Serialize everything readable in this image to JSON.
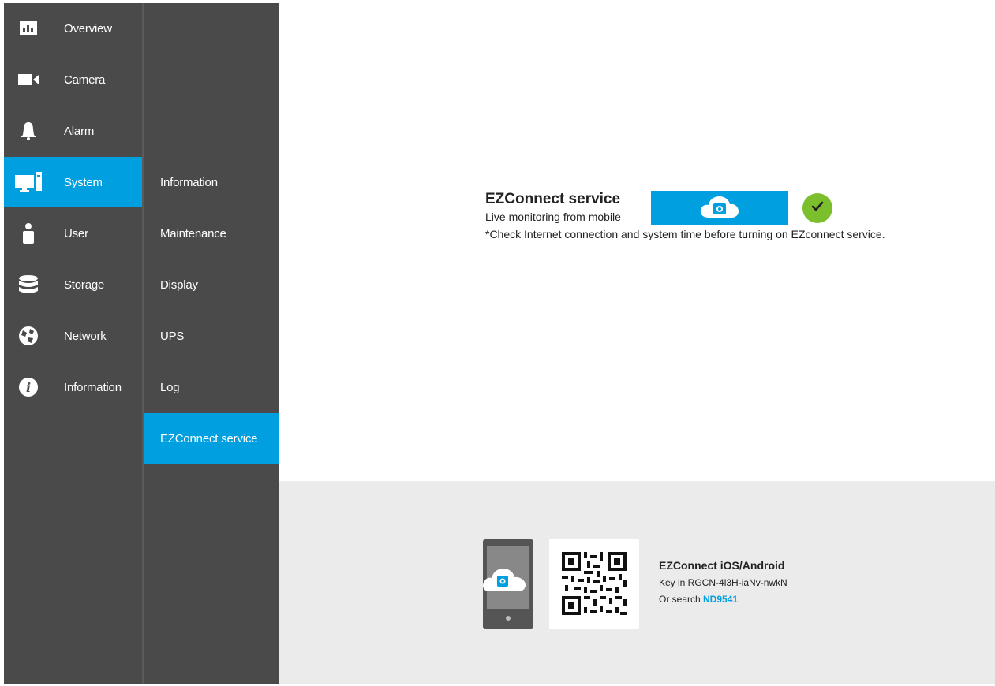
{
  "colors": {
    "sidebar_bg": "#4a4a4a",
    "accent": "#009fe0",
    "success": "#7cbf2d",
    "bottom_panel": "#ebebeb"
  },
  "sidebar": {
    "items": [
      {
        "label": "Overview",
        "icon": "overview-icon",
        "active": false
      },
      {
        "label": "Camera",
        "icon": "camera-icon",
        "active": false
      },
      {
        "label": "Alarm",
        "icon": "bell-icon",
        "active": false
      },
      {
        "label": "System",
        "icon": "system-icon",
        "active": true
      },
      {
        "label": "User",
        "icon": "user-icon",
        "active": false
      },
      {
        "label": "Storage",
        "icon": "storage-icon",
        "active": false
      },
      {
        "label": "Network",
        "icon": "globe-icon",
        "active": false
      },
      {
        "label": "Information",
        "icon": "info-icon",
        "active": false
      }
    ]
  },
  "subnav": {
    "items": [
      {
        "label": "Information",
        "active": false
      },
      {
        "label": "Maintenance",
        "active": false
      },
      {
        "label": "Display",
        "active": false
      },
      {
        "label": "UPS",
        "active": false
      },
      {
        "label": "Log",
        "active": false
      },
      {
        "label": "EZConnect service",
        "active": true
      }
    ]
  },
  "service": {
    "title": "EZConnect service",
    "subtitle": "Live monitoring from mobile",
    "note": "*Check Internet connection and system time before turning on EZconnect service.",
    "button_icon": "cloud-camera-icon",
    "status_icon": "check-icon",
    "status": "enabled"
  },
  "app": {
    "title": "EZConnect iOS/Android",
    "key_text": "Key in RGCN-4l3H-iaNv-nwkN",
    "search_prefix": "Or search ",
    "search_term": "ND9541"
  }
}
